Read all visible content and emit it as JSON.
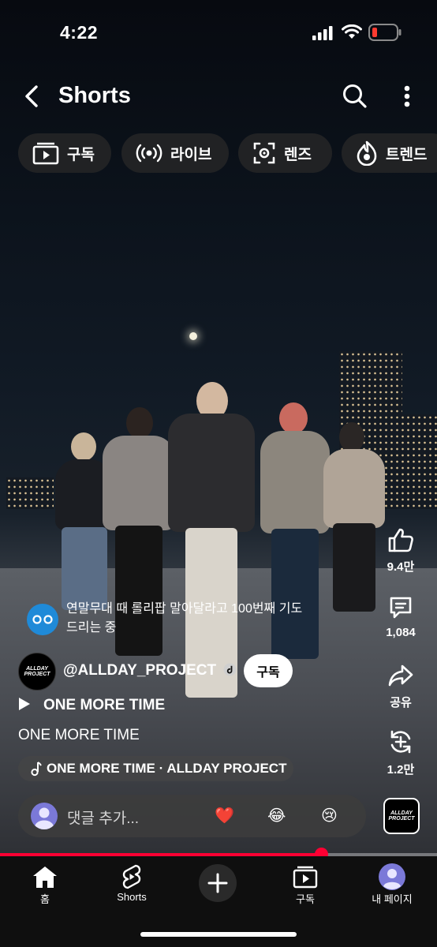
{
  "status": {
    "time": "4:22"
  },
  "header": {
    "title": "Shorts"
  },
  "chips": [
    {
      "label": "구독",
      "icon": "subscriptions-icon"
    },
    {
      "label": "라이브",
      "icon": "live-icon"
    },
    {
      "label": "렌즈",
      "icon": "lens-icon"
    },
    {
      "label": "트렌드",
      "icon": "trending-icon"
    }
  ],
  "top_comment": {
    "text": "연말무대 때 롤리팝 말아달라고 100번째 기도 드리는 중"
  },
  "channel": {
    "handle": "@ALLDAY_PROJECT",
    "subscribe_label": "구독",
    "logo_text": "ALLDAY PROJECT"
  },
  "video": {
    "playlist": "ONE MORE TIME",
    "description": "ONE MORE TIME",
    "music": "ONE MORE TIME · ALLDAY PROJECT",
    "progress": 0.735
  },
  "comment_bar": {
    "placeholder": "댓글 추가...",
    "emojis": [
      "❤️",
      "😂",
      "😢"
    ]
  },
  "actions": {
    "likes": "9.4만",
    "comments": "1,084",
    "share": "공유",
    "remix": "1.2만"
  },
  "nav": [
    {
      "label": "홈",
      "icon": "home-icon"
    },
    {
      "label": "Shorts",
      "icon": "shorts-icon"
    },
    {
      "label": "",
      "icon": "create-icon"
    },
    {
      "label": "구독",
      "icon": "subscriptions-icon"
    },
    {
      "label": "내 페이지",
      "icon": "avatar"
    }
  ],
  "colors": {
    "accent": "#ff0033",
    "chip_bg": "#282828",
    "nav_bg": "#0f0f0f"
  }
}
